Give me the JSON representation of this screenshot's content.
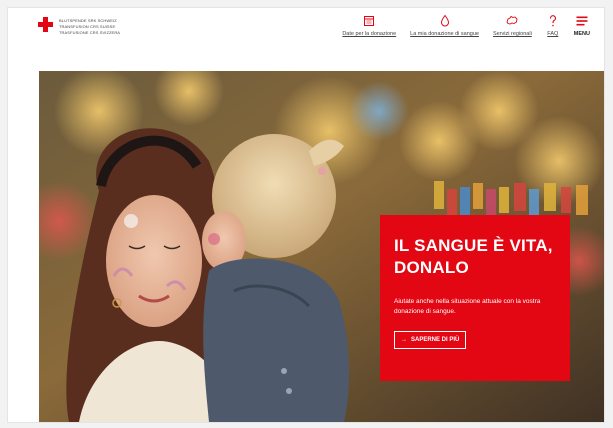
{
  "header": {
    "logo_lines": [
      "Blutspende SRK Schweiz",
      "Transfusion CRS Suisse",
      "Trasfusione CRS Svizzera"
    ],
    "nav": [
      {
        "label": "Date per la donazione",
        "icon": "calendar-icon"
      },
      {
        "label": "La mia donazione di sangue",
        "icon": "drop-icon"
      },
      {
        "label": "Servizi regionali",
        "icon": "map-icon"
      },
      {
        "label": "FAQ",
        "icon": "question-icon"
      },
      {
        "label": "MENU",
        "icon": "hamburger-icon"
      }
    ]
  },
  "hero": {
    "title_line1": "IL SANGUE È VITA,",
    "title_line2": "DONALO",
    "text": "Aiutate anche nella situazione attuale con la vostra donazione di sangue.",
    "button_arrow": "→",
    "button_label": "SAPERNE DI PIÙ"
  },
  "colors": {
    "brand_red": "#e30613",
    "text_gray": "#444444"
  }
}
